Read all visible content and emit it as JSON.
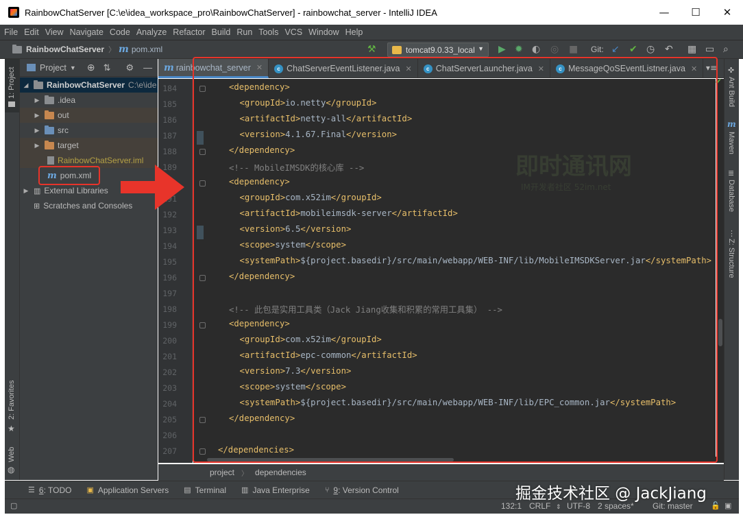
{
  "window": {
    "title": "RainbowChatServer [C:\\e\\idea_workspace_pro\\RainbowChatServer] - rainbowchat_server - IntelliJ IDEA",
    "minimize": "—",
    "maximize": "☐",
    "close": "✕"
  },
  "menu": [
    "File",
    "Edit",
    "View",
    "Navigate",
    "Code",
    "Analyze",
    "Refactor",
    "Build",
    "Run",
    "Tools",
    "VCS",
    "Window",
    "Help"
  ],
  "navbar": {
    "project": "RainbowChatServer",
    "file": "pom.xml",
    "run_config": "tomcat9.0.33_local",
    "git_label": "Git:"
  },
  "left_stripe": {
    "project": "1: Project",
    "favorites": "2: Favorites",
    "web": "Web"
  },
  "project_panel": {
    "header": "Project",
    "root_name": "RainbowChatServer",
    "root_path": "C:\\e\\ide",
    "items": [
      {
        "label": ".idea"
      },
      {
        "label": "out"
      },
      {
        "label": "src"
      },
      {
        "label": "target"
      },
      {
        "label": "RainbowChatServer.iml"
      },
      {
        "label": "pom.xml"
      }
    ],
    "external": "External Libraries",
    "scratches": "Scratches and Consoles"
  },
  "tabs": [
    {
      "label": "rainbowchat_server",
      "active": true
    },
    {
      "label": "ChatServerEventListener.java",
      "active": false
    },
    {
      "label": "ChatServerLauncher.java",
      "active": false
    },
    {
      "label": "MessageQoSEventListner.java",
      "active": false
    }
  ],
  "code_lines": [
    {
      "n": "184",
      "indent": 1,
      "tag": "<dependency>"
    },
    {
      "n": "185",
      "indent": 2,
      "open": "<groupId>",
      "text": "io.netty",
      "close": "</groupId>"
    },
    {
      "n": "186",
      "indent": 2,
      "open": "<artifactId>",
      "text": "netty-all",
      "close": "</artifactId>"
    },
    {
      "n": "187",
      "indent": 2,
      "open": "<version>",
      "text": "4.1.67.Final",
      "close": "</version>"
    },
    {
      "n": "188",
      "indent": 1,
      "tag": "</dependency>"
    },
    {
      "n": "189",
      "indent": 1,
      "comment": "<!-- MobileIMSDK的核心库 -->"
    },
    {
      "n": "190",
      "indent": 1,
      "tag": "<dependency>"
    },
    {
      "n": "191",
      "indent": 2,
      "open": "<groupId>",
      "text": "com.x52im",
      "close": "</groupId>"
    },
    {
      "n": "192",
      "indent": 2,
      "open": "<artifactId>",
      "text": "mobileimsdk-server",
      "close": "</artifactId>"
    },
    {
      "n": "193",
      "indent": 2,
      "open": "<version>",
      "text": "6.5",
      "close": "</version>"
    },
    {
      "n": "194",
      "indent": 2,
      "open": "<scope>",
      "text": "system",
      "close": "</scope>"
    },
    {
      "n": "195",
      "indent": 2,
      "open": "<systemPath>",
      "text": "${project.basedir}/src/main/webapp/WEB-INF/lib/MobileIMSDKServer.jar",
      "close": "</systemPath>"
    },
    {
      "n": "196",
      "indent": 1,
      "tag": "</dependency>"
    },
    {
      "n": "197",
      "indent": 0,
      "tag": ""
    },
    {
      "n": "198",
      "indent": 1,
      "comment": "<!-- 此包是实用工具类（Jack Jiang收集和积累的常用工具集） -->"
    },
    {
      "n": "199",
      "indent": 1,
      "tag": "<dependency>"
    },
    {
      "n": "200",
      "indent": 2,
      "open": "<groupId>",
      "text": "com.x52im",
      "close": "</groupId>"
    },
    {
      "n": "201",
      "indent": 2,
      "open": "<artifactId>",
      "text": "epc-common",
      "close": "</artifactId>"
    },
    {
      "n": "202",
      "indent": 2,
      "open": "<version>",
      "text": "7.3",
      "close": "</version>"
    },
    {
      "n": "203",
      "indent": 2,
      "open": "<scope>",
      "text": "system",
      "close": "</scope>"
    },
    {
      "n": "204",
      "indent": 2,
      "open": "<systemPath>",
      "text": "${project.basedir}/src/main/webapp/WEB-INF/lib/EPC_common.jar",
      "close": "</systemPath>"
    },
    {
      "n": "205",
      "indent": 1,
      "tag": "</dependency>"
    },
    {
      "n": "206",
      "indent": 0,
      "tag": ""
    },
    {
      "n": "207",
      "indent": 0,
      "tag": "</dependencies>"
    }
  ],
  "editor_watermark": {
    "logo": "即时通讯网",
    "sub": "IM开发者社区 52im.net"
  },
  "breadcrumb": [
    "project",
    "dependencies"
  ],
  "right_stripe": [
    "Ant Build",
    "Maven",
    "Database",
    "Z: Structure"
  ],
  "bottom_tools": [
    {
      "num": "6",
      "label": ": TODO"
    },
    {
      "num": "",
      "label": "Application Servers"
    },
    {
      "num": "",
      "label": "Terminal"
    },
    {
      "num": "",
      "label": "Java Enterprise"
    },
    {
      "num": "9",
      "label": ": Version Control"
    }
  ],
  "status": {
    "position": "132:1",
    "line_sep": "CRLF",
    "encoding": "UTF-8",
    "indent": "2 spaces*",
    "git": "Git: master"
  },
  "overlay_watermark": "掘金技术社区 @ JackJiang",
  "annotation_colors": {
    "box": "#e8342a",
    "arrow": "#e8342a"
  }
}
